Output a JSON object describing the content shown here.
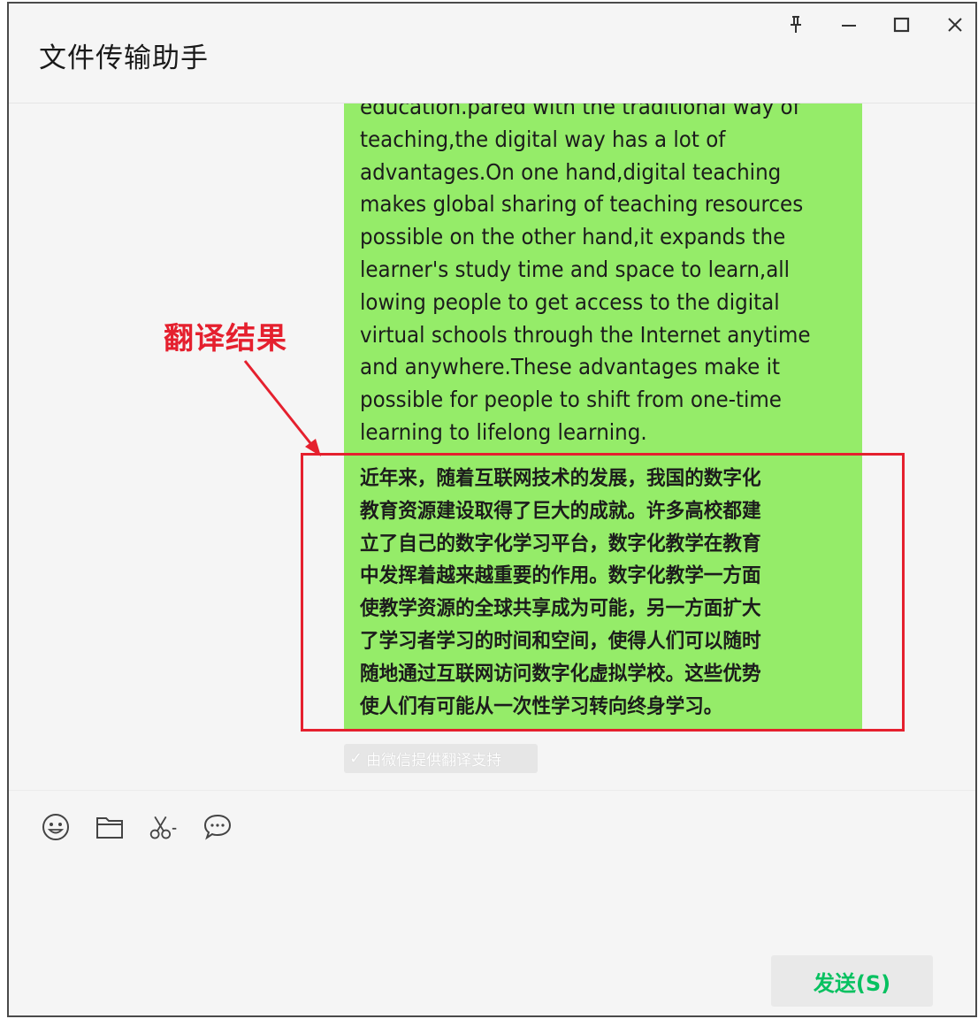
{
  "window": {
    "title": "文件传输助手",
    "controls": [
      "pin-icon",
      "minimize-icon",
      "maximize-icon",
      "close-icon"
    ]
  },
  "message": {
    "english_lines": [
      "education.pared with the traditional way of",
      "teaching,the digital way has a lot of",
      "advantages.On one hand,digital teaching",
      "makes global sharing of teaching resources",
      "possible on the other hand,it expands the",
      "learner's study time and space to learn,all",
      "lowing people to get access to the digital",
      "virtual schools through the Internet anytime",
      "and anywhere.These advantages make it",
      "possible for people to shift from one-time",
      "learning to lifelong learning."
    ],
    "chinese_lines": [
      "近年来，随着互联网技术的发展，我国的数字化",
      "教育资源建设取得了巨大的成就。许多高校都建",
      "立了自己的数字化学习平台，数字化教学在教育",
      "中发挥着越来越重要的作用。数字化教学一方面",
      "使教学资源的全球共享成为可能，另一方面扩大",
      "了学习者学习的时间和空间，使得人们可以随时",
      "随地通过互联网访问数字化虚拟学校。这些优势",
      "使人们有可能从一次性学习转向终身学习。"
    ],
    "bubble_color": "#95ec69",
    "translation_tag": "由微信提供翻译支持"
  },
  "annotation": {
    "label": "翻译结果",
    "color": "#e5202e"
  },
  "toolbar": {
    "icons": [
      "emoji-icon",
      "folder-icon",
      "scissors-icon",
      "chat-bubble-icon"
    ]
  },
  "send": {
    "label": "发送(S)",
    "color": "#07c160"
  }
}
